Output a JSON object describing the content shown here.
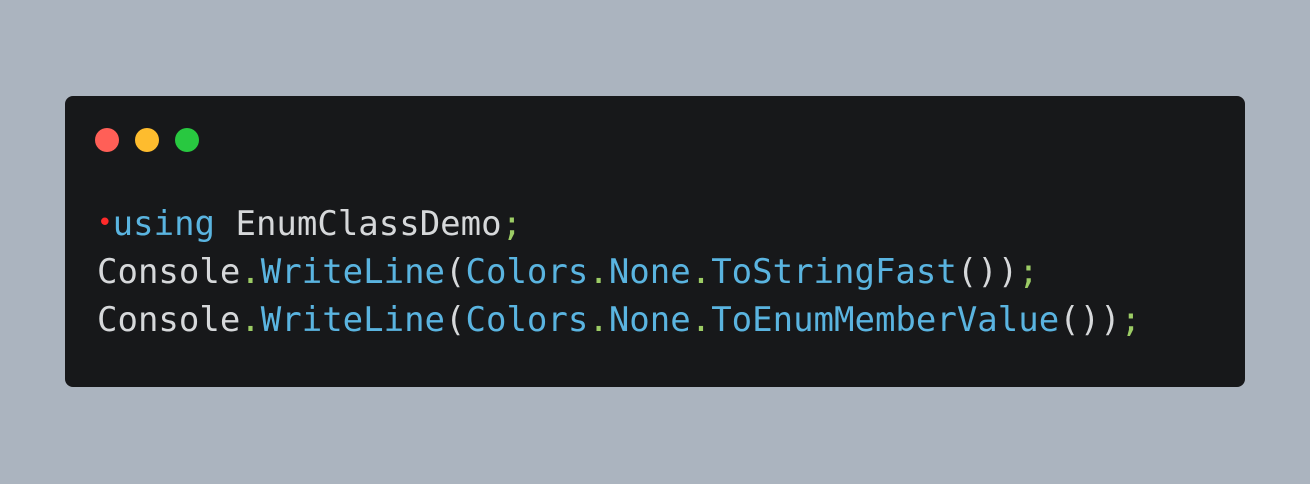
{
  "colors": {
    "background": "#abb4bf",
    "window": "#17181a",
    "dot_red": "#ff5f57",
    "dot_yellow": "#febc2e",
    "dot_green": "#28c840",
    "default_text": "#d6d8da",
    "keyword": "#5ab4e0",
    "method": "#5ab4e0",
    "punct": "#9ccc65",
    "bullet": "#ff2a2a"
  },
  "window_controls": [
    {
      "icon": "close-dot-icon",
      "color": "#ff5f57"
    },
    {
      "icon": "minimize-dot-icon",
      "color": "#febc2e"
    },
    {
      "icon": "maximize-dot-icon",
      "color": "#28c840"
    }
  ],
  "code": {
    "lines": [
      [
        {
          "text": "•",
          "kind": "bullet"
        },
        {
          "text": "using",
          "kind": "keyword"
        },
        {
          "text": " EnumClassDemo",
          "kind": "text"
        },
        {
          "text": ";",
          "kind": "punct"
        }
      ],
      [
        {
          "text": "Console",
          "kind": "text"
        },
        {
          "text": ".",
          "kind": "punct"
        },
        {
          "text": "WriteLine",
          "kind": "method"
        },
        {
          "text": "(",
          "kind": "text"
        },
        {
          "text": "Colors",
          "kind": "method"
        },
        {
          "text": ".",
          "kind": "punct"
        },
        {
          "text": "None",
          "kind": "method"
        },
        {
          "text": ".",
          "kind": "punct"
        },
        {
          "text": "ToStringFast",
          "kind": "method"
        },
        {
          "text": "())",
          "kind": "text"
        },
        {
          "text": ";",
          "kind": "punct"
        }
      ],
      [
        {
          "text": "Console",
          "kind": "text"
        },
        {
          "text": ".",
          "kind": "punct"
        },
        {
          "text": "WriteLine",
          "kind": "method"
        },
        {
          "text": "(",
          "kind": "text"
        },
        {
          "text": "Colors",
          "kind": "method"
        },
        {
          "text": ".",
          "kind": "punct"
        },
        {
          "text": "None",
          "kind": "method"
        },
        {
          "text": ".",
          "kind": "punct"
        },
        {
          "text": "ToEnumMemberValue",
          "kind": "method"
        },
        {
          "text": "())",
          "kind": "text"
        },
        {
          "text": ";",
          "kind": "punct"
        }
      ]
    ]
  }
}
